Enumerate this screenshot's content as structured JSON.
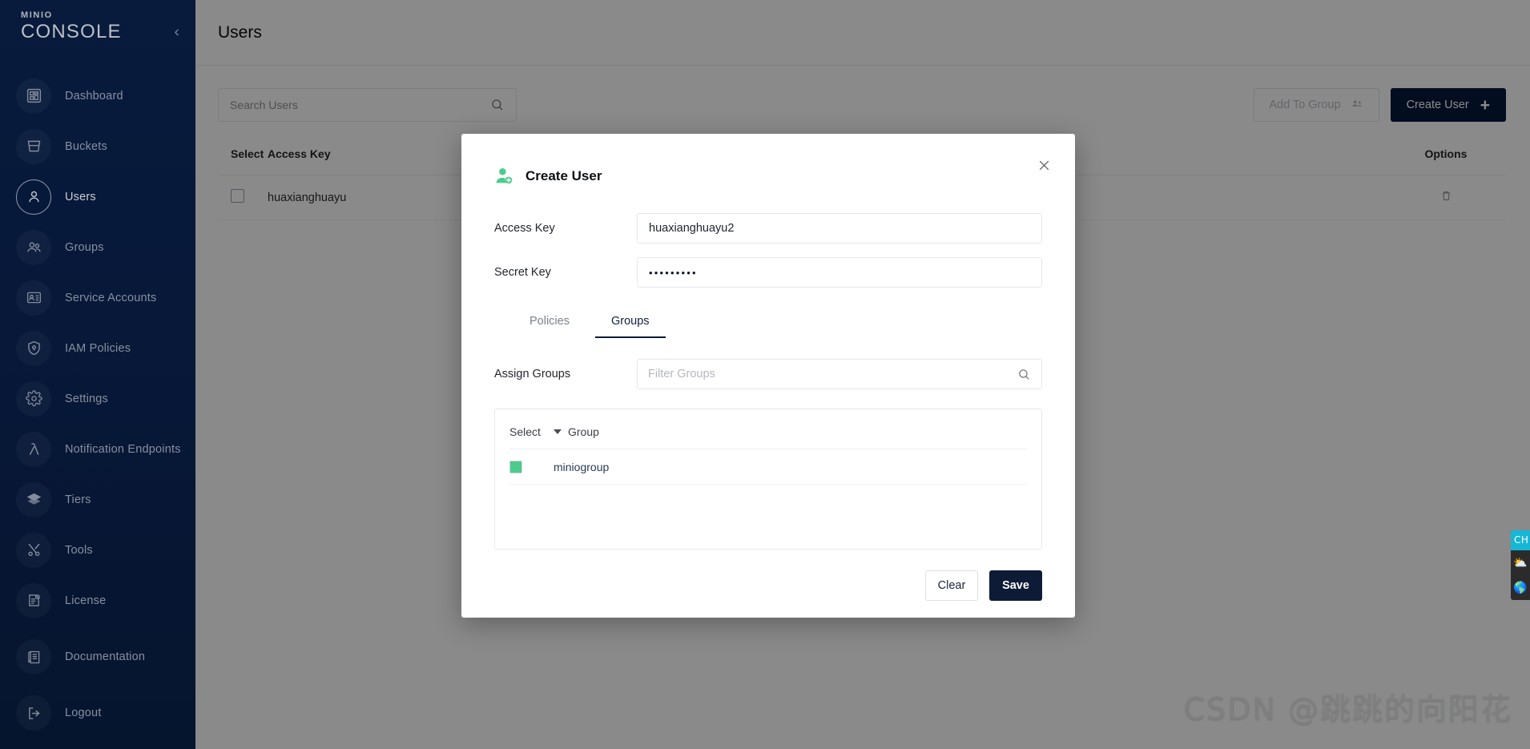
{
  "sidebar": {
    "logo_mini": "MINIO",
    "logo_main": "CONSOLE",
    "collapse_icon": "chevron-left-icon",
    "items": [
      {
        "label": "Dashboard",
        "icon": "dashboard-icon",
        "active": false
      },
      {
        "label": "Buckets",
        "icon": "bucket-icon",
        "active": false
      },
      {
        "label": "Users",
        "icon": "user-icon",
        "active": true
      },
      {
        "label": "Groups",
        "icon": "groups-icon",
        "active": false
      },
      {
        "label": "Service Accounts",
        "icon": "id-card-icon",
        "active": false
      },
      {
        "label": "IAM Policies",
        "icon": "shield-icon",
        "active": false
      },
      {
        "label": "Settings",
        "icon": "gear-icon",
        "active": false
      },
      {
        "label": "Notification Endpoints",
        "icon": "lambda-icon",
        "active": false
      },
      {
        "label": "Tiers",
        "icon": "layers-icon",
        "active": false
      },
      {
        "label": "Tools",
        "icon": "tools-icon",
        "active": false
      },
      {
        "label": "License",
        "icon": "license-doc-icon",
        "active": false
      }
    ],
    "bottom_items": [
      {
        "label": "Documentation",
        "icon": "book-icon"
      },
      {
        "label": "Logout",
        "icon": "logout-icon"
      }
    ]
  },
  "page": {
    "title": "Users",
    "search": {
      "placeholder": "Search Users",
      "value": "",
      "icon": "search-icon"
    },
    "add_to_group_label": "Add To Group",
    "add_to_group_icon": "group-add-icon",
    "create_user_label": "Create User",
    "create_user_icon": "plus-icon",
    "table": {
      "columns": [
        "Select",
        "Access Key",
        "Options"
      ],
      "rows": [
        {
          "selected": false,
          "access_key": "huaxianghuayu",
          "option_icon": "trash-icon"
        }
      ]
    },
    "watermark": "CSDN @跳跳的向阳花"
  },
  "modal": {
    "title": "Create User",
    "title_icon": "user-add-icon",
    "close_icon": "close-icon",
    "fields": {
      "access_key_label": "Access Key",
      "access_key_value": "huaxianghuayu2",
      "access_key_placeholder": "",
      "secret_key_label": "Secret Key",
      "secret_key_value": "•••••••••",
      "secret_key_placeholder": ""
    },
    "tabs": [
      {
        "label": "Policies",
        "active": false
      },
      {
        "label": "Groups",
        "active": true
      }
    ],
    "assign_groups_label": "Assign Groups",
    "filter": {
      "placeholder": "Filter Groups",
      "value": "",
      "icon": "search-icon"
    },
    "groups_table": {
      "columns": [
        "Select",
        "Group"
      ],
      "sort_icon": "caret-down-icon",
      "rows": [
        {
          "selected": true,
          "group": "miniogroup"
        }
      ]
    },
    "clear_label": "Clear",
    "save_label": "Save"
  },
  "edge_widget": {
    "tab_label": "CH",
    "icons": [
      "weather-icon",
      "globe-icon"
    ]
  },
  "colors": {
    "sidebar_bg": "#081c42",
    "accent_green": "#4ccb8d",
    "primary_dark": "#07193b",
    "tab_underline": "#0d1b36"
  }
}
